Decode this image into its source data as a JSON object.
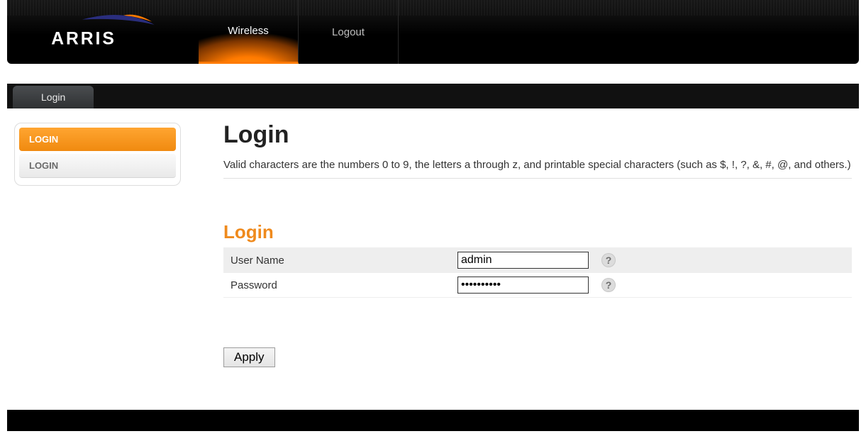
{
  "brand": "ARRIS",
  "nav": {
    "wireless": "Wireless",
    "logout": "Logout"
  },
  "subtab": "Login",
  "sidebar": {
    "items": [
      {
        "label": "LOGIN"
      },
      {
        "label": "LOGIN"
      }
    ]
  },
  "page": {
    "title": "Login",
    "description": "Valid characters are the numbers 0 to 9, the letters a through z, and printable special characters (such as $, !, ?, &, #, @, and others.)",
    "section": "Login"
  },
  "form": {
    "username_label": "User Name",
    "username_value": "admin",
    "password_label": "Password",
    "password_value": "••••••••••",
    "help_glyph": "?",
    "apply": "Apply"
  }
}
